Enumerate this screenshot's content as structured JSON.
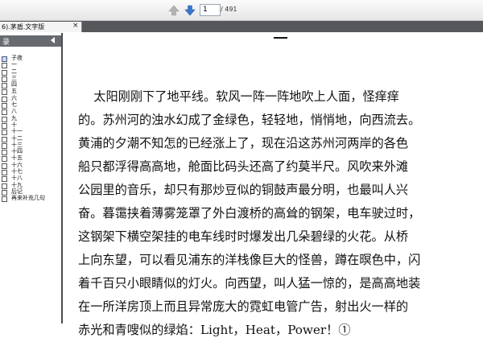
{
  "toolbar": {
    "prev_icon": "arrow-up-icon",
    "next_icon": "arrow-down-icon",
    "page_value": "1",
    "page_total": "/ 491"
  },
  "tab": {
    "label": "6).茅盾.文字版",
    "close": "×"
  },
  "sidebar": {
    "title": "录",
    "items": [
      "子夜",
      "一",
      "二",
      "三",
      "四",
      "五",
      "六",
      "七",
      "八",
      "九",
      "十",
      "十一",
      "十二",
      "十三",
      "十四",
      "十五",
      "十六",
      "十七",
      "十八",
      "十九",
      "后记",
      "再来补充几句"
    ]
  },
  "document": {
    "lines": [
      "    太阳刚刚下了地平线。软风一阵一阵地吹上人面，怪痒痒",
      "的。苏州河的浊水幻成了金绿色，轻轻地，悄悄地，向西流去。",
      "黄浦的夕潮不知怎的已经涨上了，现在沿这苏州河两岸的各色",
      "船只都浮得高高地，舱面比码头还高了约莫半尺。风吹来外滩",
      "公园里的音乐，却只有那炒豆似的铜鼓声最分明，也最叫人兴",
      "奋。暮霭挟着薄雾笼罩了外白渡桥的高耸的钢架，电车驶过时，",
      "这钢架下横空架挂的电车线时时爆发出几朵碧绿的火花。从桥",
      "上向东望，可以看见浦东的洋栈像巨大的怪兽，蹲在暝色中，闪",
      "着千百只小眼睛似的灯火。向西望，叫人猛一惊的，是高高地装",
      "在一所洋房顶上而且异常庞大的霓虹电管广告，射出火一样的",
      "赤光和青嗖似的绿焰：Light，Heat，Power！①"
    ]
  },
  "colors": {
    "toolbar_bg": "#e6e6e6",
    "tabstrip_bg": "#56575a",
    "sidebar_header_bg": "#676a6f",
    "arrow_blue": "#3a78d0",
    "arrow_gray": "#b4b4b4"
  }
}
